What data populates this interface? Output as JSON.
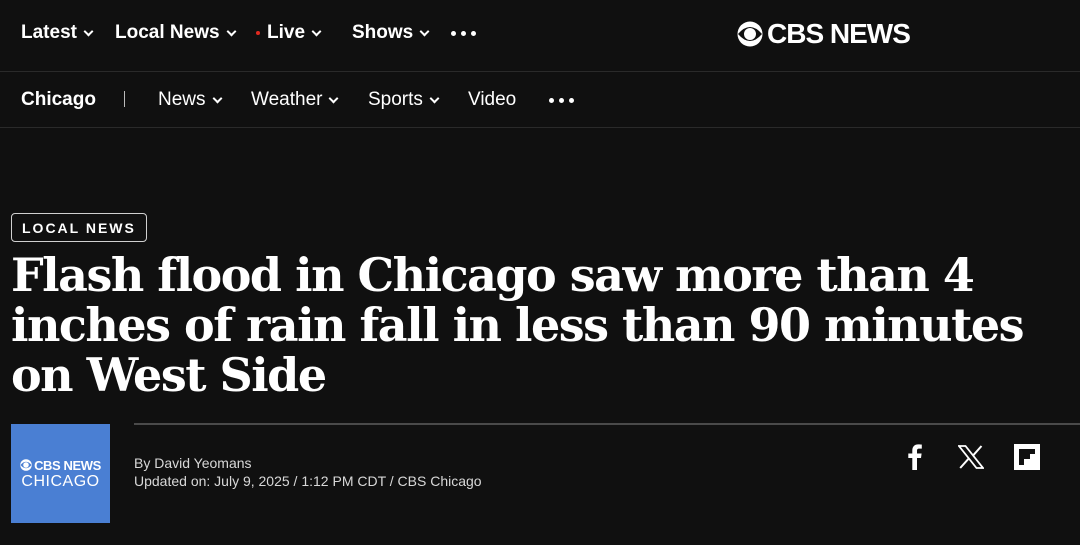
{
  "top_nav": {
    "items": [
      {
        "label": "Latest"
      },
      {
        "label": "Local News"
      },
      {
        "label": "Live"
      },
      {
        "label": "Shows"
      }
    ],
    "more_icon": "more-dots-icon",
    "live_dot_color": "#e0291f"
  },
  "logo": {
    "text": "CBS NEWS",
    "icon": "cbs-eye-icon"
  },
  "sub_nav": {
    "city": "Chicago",
    "items": [
      {
        "label": "News"
      },
      {
        "label": "Weather"
      },
      {
        "label": "Sports"
      },
      {
        "label": "Video"
      }
    ],
    "more_icon": "more-dots-icon"
  },
  "article": {
    "category": "LOCAL NEWS",
    "headline": "Flash flood in Chicago saw more than 4 inches of rain fall in less than 90 minutes on West Side",
    "author_avatar": {
      "line1": "CBS NEWS",
      "line2": "CHICAGO",
      "color": "#4a7fd3"
    },
    "byline": "By David Yeomans",
    "updated": "Updated on: July 9, 2025 / 1:12 PM CDT / CBS Chicago"
  },
  "share": {
    "icons": [
      "facebook-icon",
      "x-icon",
      "flipboard-icon"
    ]
  },
  "colors": {
    "background": "#101010",
    "text": "#ffffff",
    "accent_live": "#e0291f"
  }
}
